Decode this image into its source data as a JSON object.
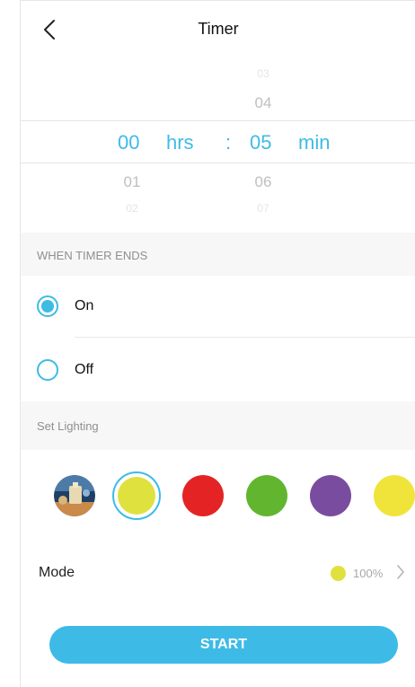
{
  "header": {
    "title": "Timer"
  },
  "picker": {
    "hours_above_far": "",
    "hours_above_near": "",
    "hours_selected": "00",
    "hours_below_near": "01",
    "hours_below_far": "02",
    "hours_unit": "hrs",
    "separator": ":",
    "minutes_above_far": "03",
    "minutes_above_near": "04",
    "minutes_selected": "05",
    "minutes_below_near": "06",
    "minutes_below_far": "07",
    "minutes_unit": "min"
  },
  "timer_end": {
    "section_label": "WHEN TIMER ENDS",
    "options": [
      {
        "label": "On",
        "selected": true
      },
      {
        "label": "Off",
        "selected": false
      }
    ]
  },
  "lighting": {
    "section_label": "Set Lighting",
    "swatches": [
      {
        "name": "scene-photo",
        "color": "#2d5a86"
      },
      {
        "name": "yellow-green",
        "color": "#dfe13f",
        "selected": true
      },
      {
        "name": "red",
        "color": "#e42424"
      },
      {
        "name": "green",
        "color": "#62b52f"
      },
      {
        "name": "purple",
        "color": "#7a4c9f"
      },
      {
        "name": "yellow",
        "color": "#f0e43b"
      }
    ]
  },
  "mode": {
    "label": "Mode",
    "value": "100%",
    "dot_color": "#dfe13f"
  },
  "start_button": {
    "label": "START"
  },
  "colors": {
    "accent": "#3dbbe6"
  }
}
